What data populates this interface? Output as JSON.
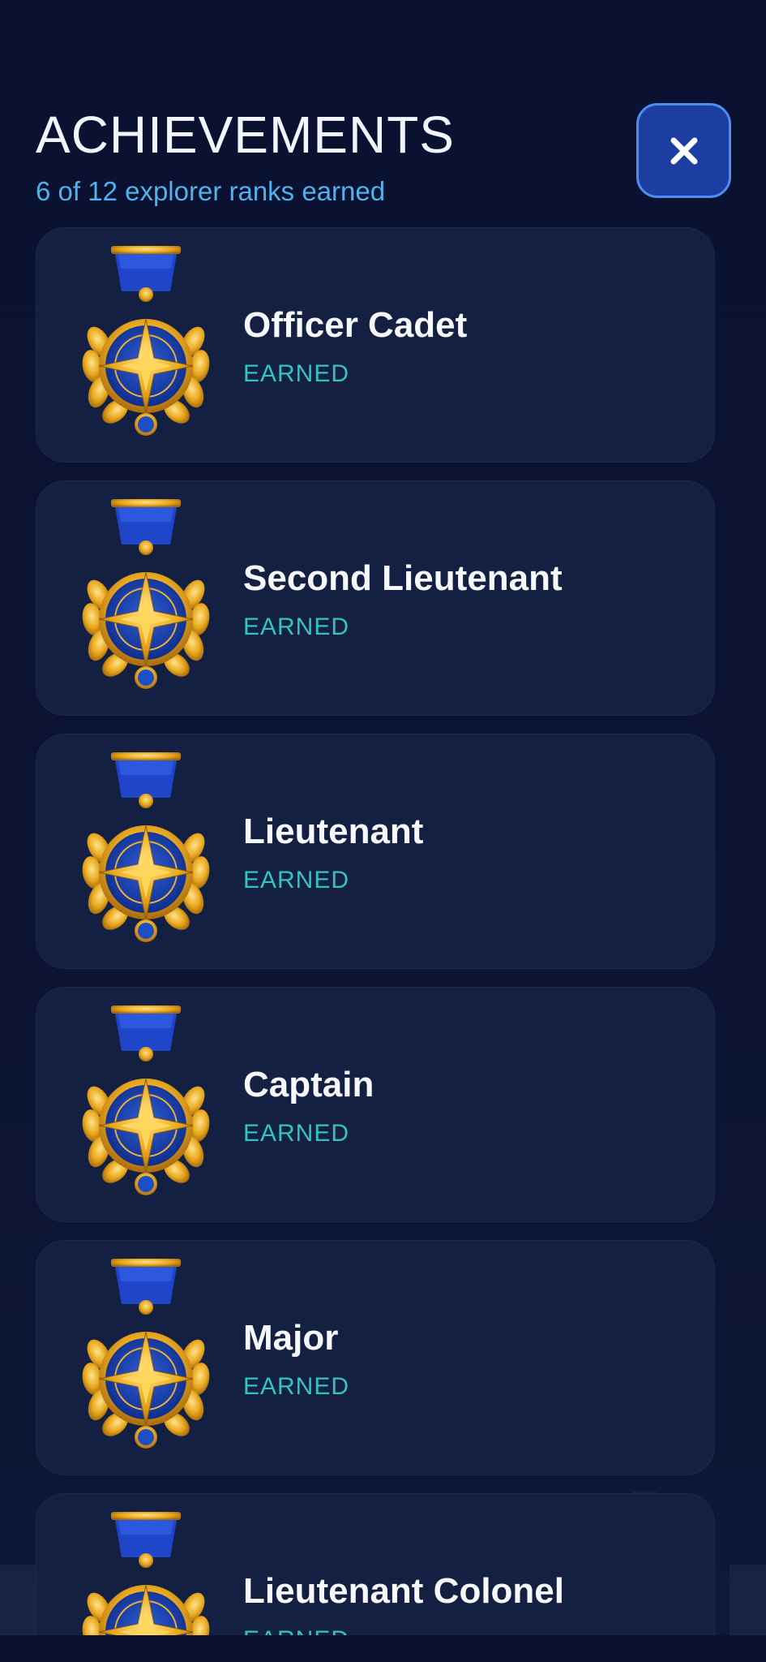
{
  "header": {
    "title": "ACHIEVEMENTS",
    "subtitle": "6 of 12 explorer ranks earned"
  },
  "close_button": {
    "icon": "close-icon"
  },
  "colors": {
    "background": "#0b1130",
    "card": "#142042",
    "accent_blue": "#4fb2ea",
    "earned": "#34c3c0",
    "button": "#1c3ea0",
    "medal_gold": "#f2b52a",
    "medal_ribbon": "#1f45c8"
  },
  "ranks": [
    {
      "name": "Officer Cadet",
      "status": "EARNED",
      "icon": "medal-icon"
    },
    {
      "name": "Second Lieutenant",
      "status": "EARNED",
      "icon": "medal-icon"
    },
    {
      "name": "Lieutenant",
      "status": "EARNED",
      "icon": "medal-icon"
    },
    {
      "name": "Captain",
      "status": "EARNED",
      "icon": "medal-icon"
    },
    {
      "name": "Major",
      "status": "EARNED",
      "icon": "medal-icon"
    },
    {
      "name": "Lieutenant Colonel",
      "status": "EARNED",
      "icon": "medal-icon"
    }
  ]
}
